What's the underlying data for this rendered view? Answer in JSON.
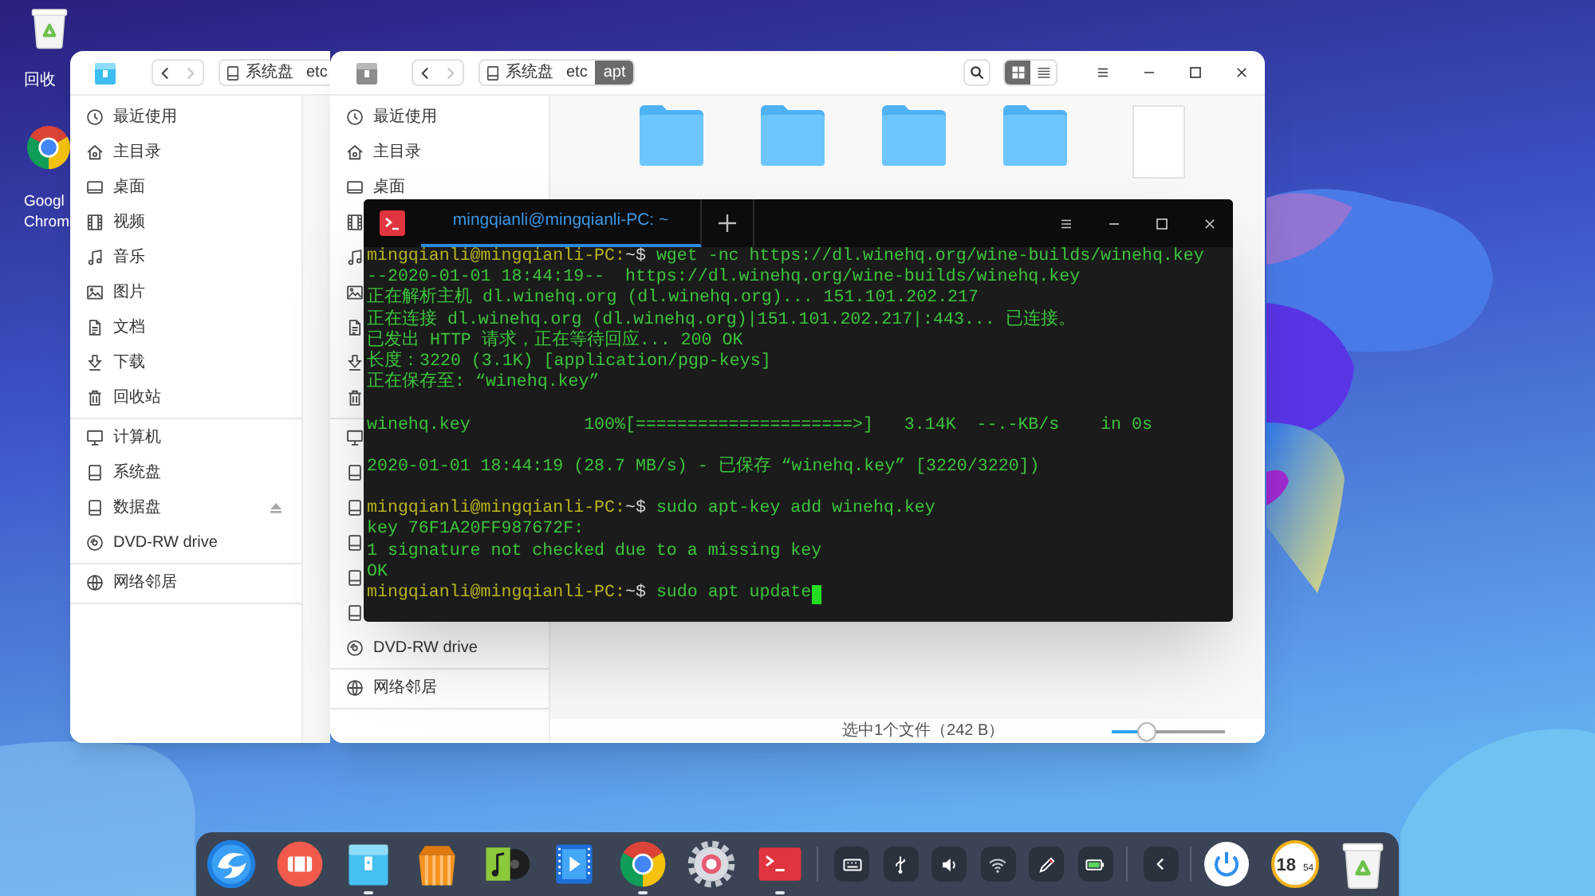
{
  "desktop_icons": [
    {
      "kind": "trash",
      "label_lines": [
        "回收"
      ]
    },
    {
      "kind": "browser",
      "label_lines": [
        "Googl",
        "Chrom"
      ]
    }
  ],
  "file_manager_back": {
    "app_icon_active": true,
    "nav": [
      {
        "kind": "back",
        "disabled": false
      },
      {
        "kind": "forward",
        "disabled": true
      }
    ],
    "breadcrumb": [
      {
        "kind": "drive",
        "label": "系统盘",
        "selected": false
      },
      {
        "kind": "folder",
        "label": "etc",
        "selected": false
      }
    ],
    "sidebar": [
      [
        {
          "kind": "recent",
          "label": "最近使用",
          "ejectable": false
        },
        {
          "kind": "home",
          "label": "主目录",
          "ejectable": false
        },
        {
          "kind": "desktop",
          "label": "桌面",
          "ejectable": false
        },
        {
          "kind": "video",
          "label": "视频",
          "ejectable": false
        },
        {
          "kind": "music",
          "label": "音乐",
          "ejectable": false
        },
        {
          "kind": "pictures",
          "label": "图片",
          "ejectable": false
        },
        {
          "kind": "documents",
          "label": "文档",
          "ejectable": false
        },
        {
          "kind": "downloads",
          "label": "下载",
          "ejectable": false
        },
        {
          "kind": "trash",
          "label": "回收站",
          "ejectable": false
        }
      ],
      [
        {
          "kind": "computer",
          "label": "计算机",
          "ejectable": false
        },
        {
          "kind": "drive",
          "label": "系统盘",
          "ejectable": false
        },
        {
          "kind": "drive",
          "label": "数据盘",
          "ejectable": true
        },
        {
          "kind": "disc",
          "label": "DVD-RW drive",
          "ejectable": false
        }
      ],
      [
        {
          "kind": "network",
          "label": "网络邻居",
          "ejectable": false
        }
      ]
    ]
  },
  "file_manager_front": {
    "app_icon_active": false,
    "nav": [
      {
        "kind": "back",
        "disabled": false
      },
      {
        "kind": "forward",
        "disabled": true
      }
    ],
    "breadcrumb": [
      {
        "kind": "drive",
        "label": "系统盘",
        "selected": false
      },
      {
        "kind": "folder",
        "label": "etc",
        "selected": false
      },
      {
        "kind": "folder",
        "label": "apt",
        "selected": true
      }
    ],
    "view_modes": [
      {
        "kind": "grid",
        "selected": true
      },
      {
        "kind": "list",
        "selected": false
      }
    ],
    "sidebar": [
      [
        {
          "kind": "recent",
          "label": "最近使用"
        },
        {
          "kind": "home",
          "label": "主目录"
        },
        {
          "kind": "desktop",
          "label": "桌面"
        },
        {
          "kind": "video"
        },
        {
          "kind": "music"
        },
        {
          "kind": "pictures"
        },
        {
          "kind": "documents"
        },
        {
          "kind": "downloads"
        },
        {
          "kind": "trash"
        }
      ],
      [
        {
          "kind": "computer"
        },
        {
          "kind": "drive"
        },
        {
          "kind": "drive"
        },
        {
          "kind": "drive"
        },
        {
          "kind": "drive"
        },
        {
          "kind": "drive"
        },
        {
          "kind": "disc",
          "label": "DVD-RW drive"
        }
      ],
      [
        {
          "kind": "network",
          "label": "网络邻居"
        }
      ]
    ],
    "files": [
      {
        "kind": "folder"
      },
      {
        "kind": "folder"
      },
      {
        "kind": "folder"
      },
      {
        "kind": "folder"
      },
      {
        "kind": "file"
      }
    ],
    "status": "选中1个文件（242 B）",
    "icon_size_slider": {
      "level": 0.27
    }
  },
  "terminal": {
    "tabs": [
      {
        "title": "mingqianli@mingqianli-PC: ~",
        "selected": true
      }
    ],
    "lines": [
      {
        "kind": "prompt",
        "host": "mingqianli@mingqianli-PC:",
        "path": "~$",
        "command": "wget -nc https://dl.winehq.org/wine-builds/winehq.key",
        "cursor": false
      },
      {
        "kind": "output",
        "text": "--2020-01-01 18:44:19--  https://dl.winehq.org/wine-builds/winehq.key"
      },
      {
        "kind": "output",
        "text": "正在解析主机 dl.winehq.org (dl.winehq.org)... 151.101.202.217"
      },
      {
        "kind": "output",
        "text": "正在连接 dl.winehq.org (dl.winehq.org)|151.101.202.217|:443... 已连接。"
      },
      {
        "kind": "output",
        "text": "已发出 HTTP 请求，正在等待回应... 200 OK"
      },
      {
        "kind": "output",
        "text": "长度：3220 (3.1K) [application/pgp-keys]"
      },
      {
        "kind": "output",
        "text": "正在保存至: “winehq.key”"
      },
      {
        "kind": "blank"
      },
      {
        "kind": "output",
        "text": "winehq.key           100%[=====================>]   3.14K  --.-KB/s    in 0s"
      },
      {
        "kind": "blank"
      },
      {
        "kind": "output",
        "text": "2020-01-01 18:44:19 (28.7 MB/s) - 已保存 “winehq.key” [3220/3220])"
      },
      {
        "kind": "blank"
      },
      {
        "kind": "prompt",
        "host": "mingqianli@mingqianli-PC:",
        "path": "~$",
        "command": "sudo apt-key add winehq.key",
        "cursor": false
      },
      {
        "kind": "output",
        "text": "key 76F1A20FF987672F:"
      },
      {
        "kind": "output",
        "text": "1 signature not checked due to a missing key"
      },
      {
        "kind": "output",
        "text": "OK"
      },
      {
        "kind": "prompt",
        "host": "mingqianli@mingqianli-PC:",
        "path": "~$",
        "command": "sudo apt update",
        "cursor": true
      }
    ]
  },
  "dock": {
    "apps": [
      {
        "kind": "launcher",
        "running": false
      },
      {
        "kind": "recorder",
        "running": false
      },
      {
        "kind": "files",
        "running": true
      },
      {
        "kind": "store",
        "running": false
      },
      {
        "kind": "music",
        "running": false
      },
      {
        "kind": "video",
        "running": false
      },
      {
        "kind": "browser",
        "running": true
      },
      {
        "kind": "settings",
        "running": false
      },
      {
        "kind": "terminal",
        "running": true
      }
    ],
    "tray": [
      {
        "kind": "keyboard"
      },
      {
        "kind": "usb"
      },
      {
        "kind": "volume"
      },
      {
        "kind": "wifi"
      },
      {
        "kind": "pen"
      },
      {
        "kind": "battery"
      }
    ],
    "clock": {
      "hours": "18",
      "minutes": "54"
    }
  }
}
